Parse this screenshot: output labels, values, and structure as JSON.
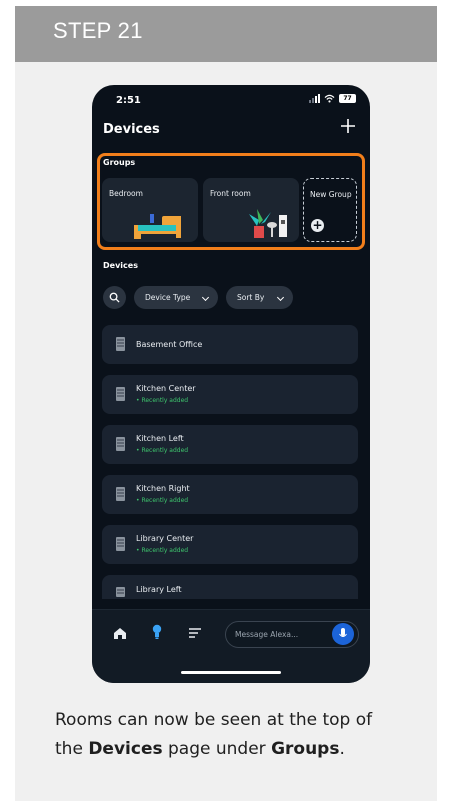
{
  "step": {
    "title": "STEP 21"
  },
  "caption": {
    "part1": "Rooms can now be seen at the top of the ",
    "bold1": "Devices",
    "part2": " page under ",
    "bold2": "Groups",
    "part3": "."
  },
  "phone": {
    "status": {
      "time": "2:51",
      "battery": "77"
    },
    "title": "Devices",
    "groups": {
      "label": "Groups",
      "tiles": [
        {
          "label": "Bedroom",
          "icon": "bed-icon"
        },
        {
          "label": "Front room",
          "icon": "plant-lamp-icon"
        },
        {
          "label": "New Group",
          "icon": "add-icon"
        }
      ]
    },
    "devices": {
      "label": "Devices",
      "filters": {
        "type": "Device Type",
        "sort": "Sort By"
      },
      "items": [
        {
          "name": "Basement Office",
          "status": ""
        },
        {
          "name": "Kitchen Center",
          "status": "• Recently added"
        },
        {
          "name": "Kitchen Left",
          "status": "• Recently added"
        },
        {
          "name": "Kitchen Right",
          "status": "• Recently added"
        },
        {
          "name": "Library Center",
          "status": "• Recently added"
        },
        {
          "name": "Library Left",
          "status": ""
        }
      ]
    },
    "bottom": {
      "message_placeholder": "Message Alexa..."
    },
    "colors": {
      "highlight": "#f27f1b",
      "accent": "#1c64d8",
      "added": "#3ec46d"
    }
  }
}
